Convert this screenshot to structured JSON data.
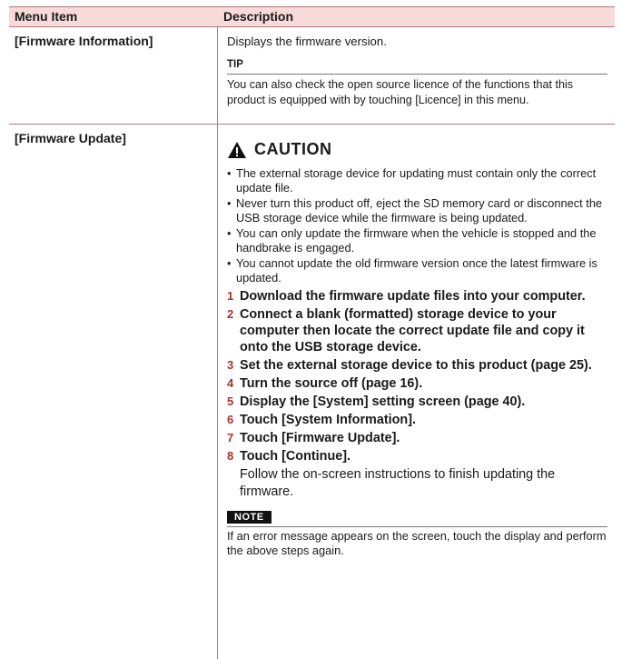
{
  "table": {
    "headers": {
      "menu_item": "Menu Item",
      "description": "Description"
    },
    "rows": [
      {
        "item": "[Firmware Information]",
        "text": "Displays the firmware version.",
        "tip_label": "TIP",
        "tip_text": "You can also check the open source licence of the functions that this product is equipped with by touching [Licence] in this menu."
      },
      {
        "item": "[Firmware Update]",
        "caution_label": "CAUTION",
        "caution_items": [
          "The external storage device for updating must contain only the correct update file.",
          "Never turn this product off, eject the SD memory card or disconnect the USB storage device while the firmware is being updated.",
          "You can only update the firmware when the vehicle is stopped and the handbrake is engaged.",
          "You cannot update the old firmware version once the latest firmware is updated."
        ],
        "steps": [
          {
            "num": "1",
            "text": "Download the firmware update files into your computer."
          },
          {
            "num": "2",
            "text": "Connect a blank (formatted) storage device to your computer then locate the correct update file and copy it onto the USB storage device."
          },
          {
            "num": "3",
            "text": "Set the external storage device to this product (page 25)."
          },
          {
            "num": "4",
            "text": "Turn the source off (page 16)."
          },
          {
            "num": "5",
            "text": "Display the [System] setting screen (page 40)."
          },
          {
            "num": "6",
            "text": "Touch [System Information]."
          },
          {
            "num": "7",
            "text": "Touch [Firmware Update]."
          },
          {
            "num": "8",
            "text": "Touch [Continue]."
          }
        ],
        "follow_text": "Follow the on-screen instructions to finish updating the firmware.",
        "note_label": "NOTE",
        "note_text": "If an error message appears on the screen, touch the display and perform the above steps again."
      }
    ]
  }
}
